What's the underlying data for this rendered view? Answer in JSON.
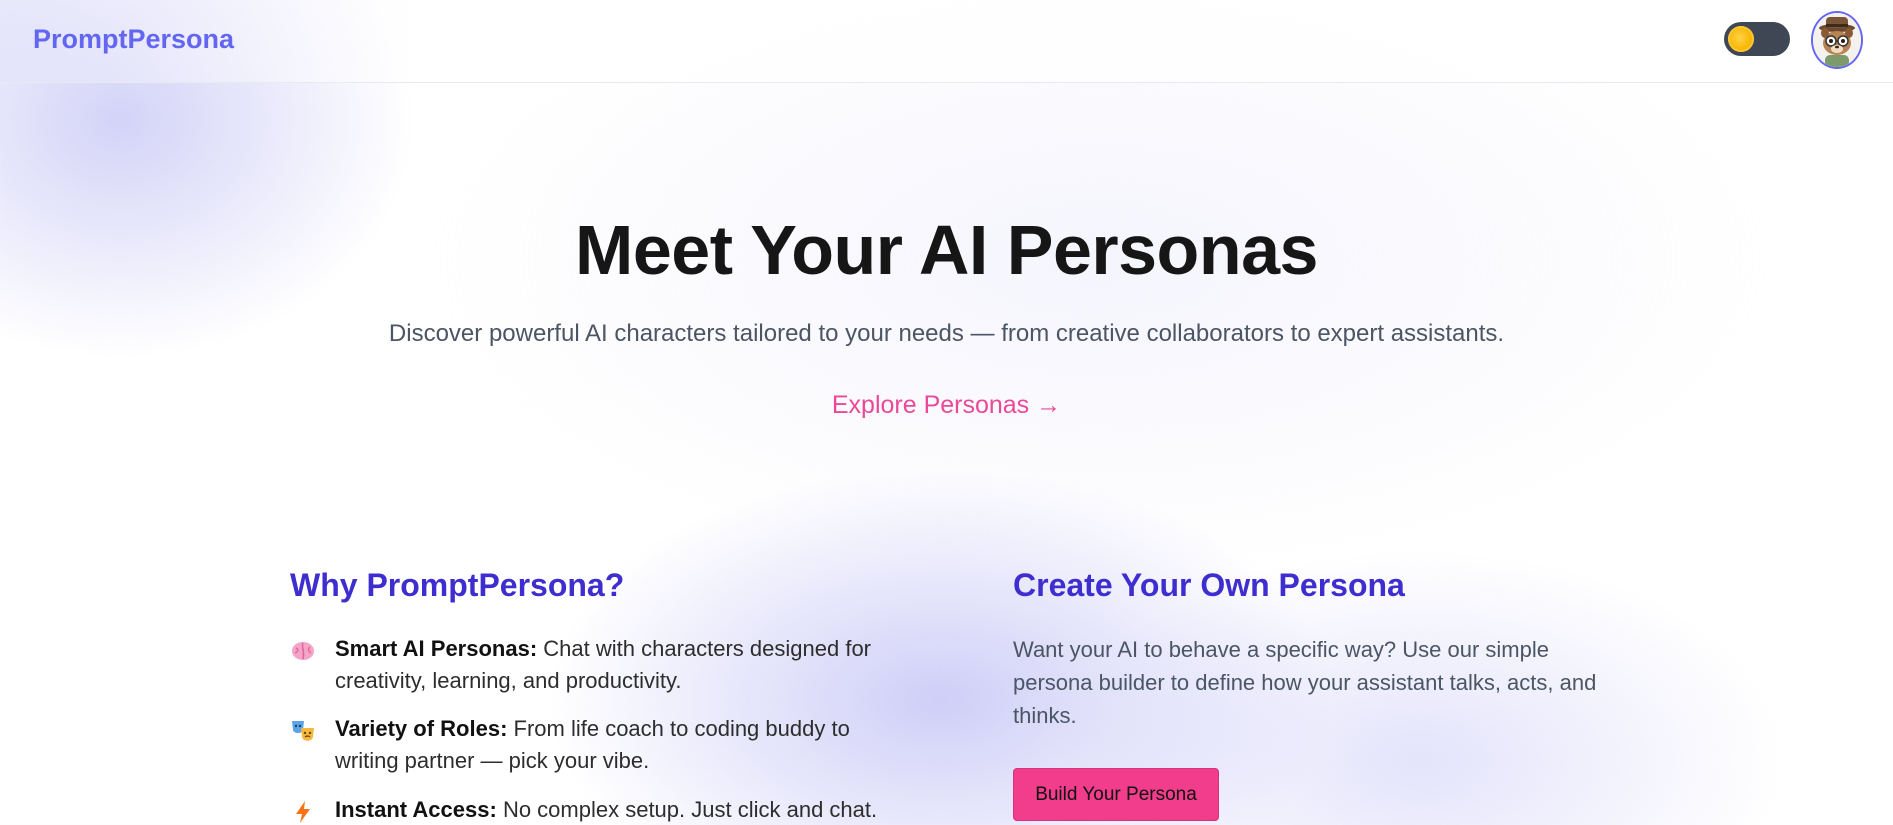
{
  "header": {
    "brand": "PromptPersona",
    "theme_toggle_icon": "sun-icon",
    "avatar_icon": "raccoon-avatar-icon"
  },
  "hero": {
    "title": "Meet Your AI Personas",
    "subtitle": "Discover powerful AI characters tailored to your needs — from creative collaborators to expert assistants.",
    "cta_link": "Explore Personas →"
  },
  "why": {
    "heading": "Why PromptPersona?",
    "features": [
      {
        "icon": "brain-icon",
        "title": "Smart AI Personas:",
        "text": "Chat with characters designed for creativity, learning, and productivity."
      },
      {
        "icon": "theater-masks-icon",
        "title": "Variety of Roles:",
        "text": "From life coach to coding buddy to writing partner — pick your vibe."
      },
      {
        "icon": "lightning-icon",
        "title": "Instant Access:",
        "text": "No complex setup. Just click and chat."
      }
    ]
  },
  "create": {
    "heading": "Create Your Own Persona",
    "description": "Want your AI to behave a specific way? Use our simple persona builder to define how your assistant talks, acts, and thinks.",
    "button_label": "Build Your Persona"
  },
  "colors": {
    "brand": "#6366f1",
    "heading": "#3f2ecf",
    "accent_pink": "#ec4899",
    "button": "#f23d8c"
  }
}
